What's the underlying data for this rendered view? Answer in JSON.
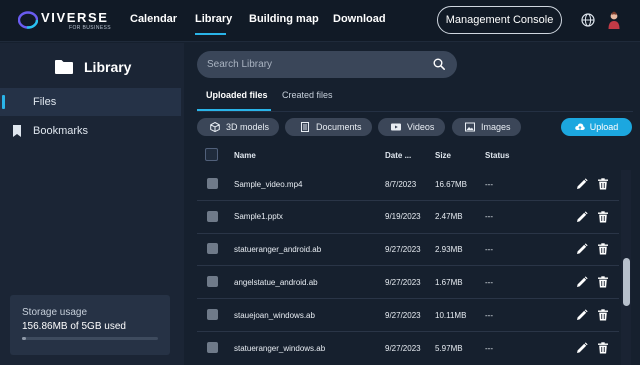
{
  "brand": {
    "name": "VIVERSE",
    "sub": "FOR BUSINESS"
  },
  "nav": {
    "items": [
      {
        "label": "Calendar",
        "active": false
      },
      {
        "label": "Library",
        "active": true
      },
      {
        "label": "Building map",
        "active": false
      },
      {
        "label": "Download",
        "active": false
      }
    ],
    "management_console": "Management Console",
    "icons": [
      "globe-icon",
      "avatar"
    ]
  },
  "sidebar": {
    "title": "Library",
    "items": [
      {
        "label": "Files",
        "active": true,
        "icon": "file-icon"
      },
      {
        "label": "Bookmarks",
        "active": false,
        "icon": "bookmark-icon"
      }
    ],
    "storage": {
      "title": "Storage usage",
      "value": "156.86MB of 5GB used",
      "fraction": 0.031
    }
  },
  "search": {
    "placeholder": "Search Library"
  },
  "tabs": [
    {
      "label": "Uploaded files",
      "active": true
    },
    {
      "label": "Created files",
      "active": false
    }
  ],
  "filters": [
    {
      "label": "3D models",
      "icon": "cube-icon"
    },
    {
      "label": "Documents",
      "icon": "document-icon"
    },
    {
      "label": "Videos",
      "icon": "video-icon"
    },
    {
      "label": "Images",
      "icon": "image-icon"
    }
  ],
  "upload_label": "Upload",
  "table": {
    "columns": [
      "Name",
      "Date ...",
      "Size",
      "Status"
    ],
    "rows": [
      {
        "name": "Sample_video.mp4",
        "date": "8/7/2023",
        "size": "16.67MB",
        "status": "---"
      },
      {
        "name": "Sample1.pptx",
        "date": "9/19/2023",
        "size": "2.47MB",
        "status": "---"
      },
      {
        "name": "statueranger_android.ab",
        "date": "9/27/2023",
        "size": "2.93MB",
        "status": "---"
      },
      {
        "name": "angelstatue_android.ab",
        "date": "9/27/2023",
        "size": "1.67MB",
        "status": "---"
      },
      {
        "name": "stauejoan_windows.ab",
        "date": "9/27/2023",
        "size": "10.11MB",
        "status": "---"
      },
      {
        "name": "statueranger_windows.ab",
        "date": "9/27/2023",
        "size": "5.97MB",
        "status": "---"
      }
    ]
  },
  "colors": {
    "accent": "#2ab4e8",
    "upload": "#1ca7df",
    "background": "#16202e"
  }
}
